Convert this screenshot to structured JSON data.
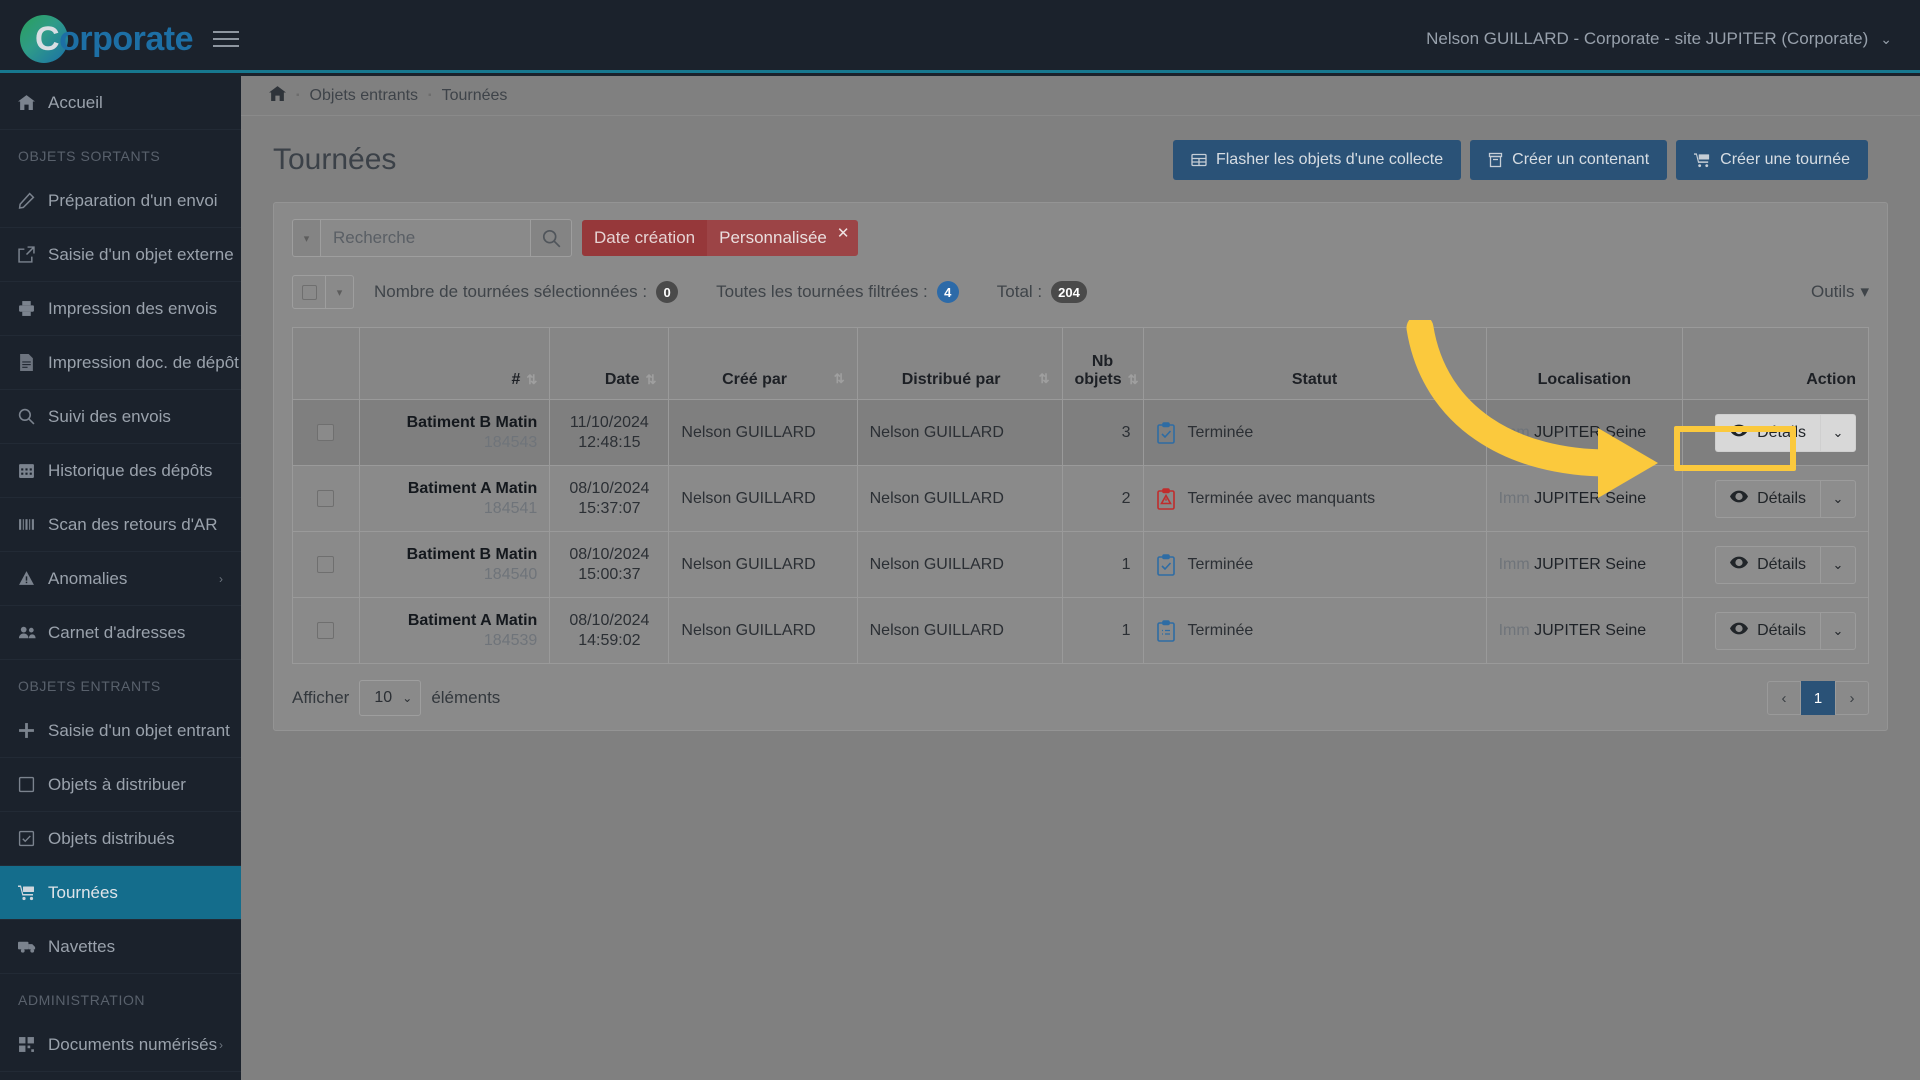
{
  "brand": {
    "c": "C",
    "rest": "orporate"
  },
  "topnav": {
    "user": "Nelson GUILLARD - Corporate - site JUPITER (Corporate)",
    "caret": "⌄",
    "menu_icon": "hamburger-icon"
  },
  "sidebar": {
    "home": {
      "label": "Accueil",
      "icon": "home-icon"
    },
    "section_sortants": "OBJETS SORTANTS",
    "section_entrants": "OBJETS ENTRANTS",
    "section_admin": "ADMINISTRATION",
    "items_sortants": [
      {
        "label": "Préparation d'un envoi",
        "icon": "pencil-icon"
      },
      {
        "label": "Saisie d'un objet externe",
        "icon": "external-link-icon"
      },
      {
        "label": "Impression des envois",
        "icon": "printer-icon"
      },
      {
        "label": "Impression doc. de dépôt",
        "icon": "document-icon"
      },
      {
        "label": "Suivi des envois",
        "icon": "search-icon"
      },
      {
        "label": "Historique des dépôts",
        "icon": "calendar-icon"
      },
      {
        "label": "Scan des retours d'AR",
        "icon": "barcode-icon"
      },
      {
        "label": "Anomalies",
        "icon": "warning-triangle-icon",
        "chevron": "›"
      },
      {
        "label": "Carnet d'adresses",
        "icon": "users-icon"
      }
    ],
    "items_entrants": [
      {
        "label": "Saisie d'un objet entrant",
        "icon": "plus-icon"
      },
      {
        "label": "Objets à distribuer",
        "icon": "square-icon"
      },
      {
        "label": "Objets distribués",
        "icon": "check-square-icon"
      },
      {
        "label": "Tournées",
        "icon": "cart-icon",
        "active": true
      },
      {
        "label": "Navettes",
        "icon": "truck-icon"
      }
    ],
    "items_admin": [
      {
        "label": "Documents numérisés",
        "icon": "grid-icon",
        "chevron": "›"
      }
    ]
  },
  "breadcrumb": {
    "home_icon": "home-icon",
    "items": [
      "Objets entrants",
      "Tournées"
    ],
    "sep": "▪"
  },
  "page": {
    "title": "Tournées"
  },
  "toolbar": {
    "flash_label": "Flasher les objets d'une collecte",
    "flash_icon": "table-icon",
    "contenant_label": "Créer un contenant",
    "contenant_icon": "box-icon",
    "tournee_label": "Créer une tournée",
    "tournee_icon": "cart-icon"
  },
  "filters": {
    "search_placeholder": "Recherche",
    "search_value": "",
    "search_icon": "search-icon",
    "dropdown_caret": "▾",
    "tag_label": "Date création",
    "tag_value": "Personnalisée",
    "tag_close": "✕"
  },
  "meta": {
    "selected_label": "Nombre de tournées sélectionnées :",
    "selected_count": "0",
    "filtered_label": "Toutes les tournées filtrées :",
    "filtered_count": "4",
    "total_label": "Total :",
    "total_count": "204",
    "tools_label": "Outils",
    "tools_caret": "▾"
  },
  "table": {
    "headers": {
      "num": "#",
      "date": "Date",
      "cree": "Créé par",
      "distribue": "Distribué par",
      "nb_l1": "Nb",
      "nb_l2": "objets",
      "statut": "Statut",
      "localisation": "Localisation",
      "action": "Action"
    },
    "sort_icon": "sort-icon",
    "rows": [
      {
        "name": "Batiment B Matin",
        "id": "184543",
        "date": "11/10/2024",
        "time": "12:48:15",
        "cree_par": "Nelson GUILLARD",
        "distribue_par": "Nelson GUILLARD",
        "nb_objets": "3",
        "statut": "Terminée",
        "statut_icon": "clipboard-check-icon",
        "statut_color": "#2e6ca4",
        "loc_prefix": "Imm",
        "loc_name": "JUPITER Seine",
        "action_label": "Détails",
        "action_icon": "eye-icon",
        "action_caret": "⌄",
        "highlighted": true
      },
      {
        "name": "Batiment A Matin",
        "id": "184541",
        "date": "08/10/2024",
        "time": "15:37:07",
        "cree_par": "Nelson GUILLARD",
        "distribue_par": "Nelson GUILLARD",
        "nb_objets": "2",
        "statut": "Terminée avec manquants",
        "statut_icon": "clipboard-alert-icon",
        "statut_color": "#c02c2c",
        "loc_prefix": "Imm",
        "loc_name": "JUPITER Seine",
        "action_label": "Détails",
        "action_icon": "eye-icon",
        "action_caret": "⌄",
        "highlighted": false
      },
      {
        "name": "Batiment B Matin",
        "id": "184540",
        "date": "08/10/2024",
        "time": "15:00:37",
        "cree_par": "Nelson GUILLARD",
        "distribue_par": "Nelson GUILLARD",
        "nb_objets": "1",
        "statut": "Terminée",
        "statut_icon": "clipboard-check-icon",
        "statut_color": "#2e6ca4",
        "loc_prefix": "Imm",
        "loc_name": "JUPITER Seine",
        "action_label": "Détails",
        "action_icon": "eye-icon",
        "action_caret": "⌄",
        "highlighted": false
      },
      {
        "name": "Batiment A Matin",
        "id": "184539",
        "date": "08/10/2024",
        "time": "14:59:02",
        "cree_par": "Nelson GUILLARD",
        "distribue_par": "Nelson GUILLARD",
        "nb_objets": "1",
        "statut": "Terminée",
        "statut_icon": "clipboard-list-icon",
        "statut_color": "#2e6ca4",
        "loc_prefix": "Imm",
        "loc_name": "JUPITER Seine",
        "action_label": "Détails",
        "action_icon": "eye-icon",
        "action_caret": "⌄",
        "highlighted": false
      }
    ]
  },
  "footer": {
    "afficher_label": "Afficher",
    "page_size": "10",
    "elements_label": "éléments",
    "prev": "‹",
    "page_1": "1",
    "next": "›"
  },
  "annotation": {
    "arrow_color": "#fbc93d",
    "highlight_color": "#fbc93d"
  }
}
